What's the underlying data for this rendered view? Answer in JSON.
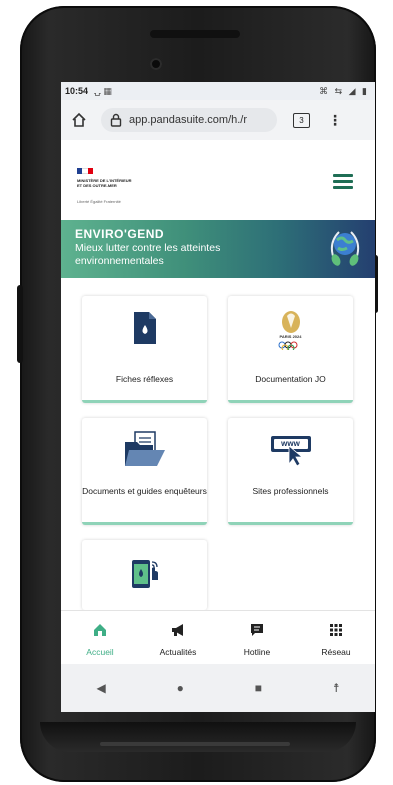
{
  "status_bar": {
    "time": "10:54",
    "left_icons": "⍽ ▦",
    "right_icons": "⌘ ⇆ ◢ ▮"
  },
  "browser": {
    "url": "app.pandasuite.com/h./r",
    "tab_count": "3"
  },
  "site": {
    "ministry": "Ministère de l'intérieur et des outre-mer",
    "devise": "Liberté Égalité Fraternité",
    "tricolor": [
      "#1f3f91",
      "#ffffff",
      "#e1000f"
    ],
    "accent_color": "#3fae86"
  },
  "banner": {
    "title": "ENVIRO'GEND",
    "subtitle": "Mieux lutter contre les atteintes environnementales"
  },
  "cards": [
    {
      "label": "Fiches réflexes",
      "icon": "file-drop-icon"
    },
    {
      "label": "Documentation JO",
      "icon": "paris-2024-logo-icon",
      "logo_text": "PARIS 2024"
    },
    {
      "label": "Documents et guides enquêteurs",
      "icon": "folder-documents-icon"
    },
    {
      "label": "Sites professionnels",
      "icon": "www-cursor-icon",
      "icon_text": "www"
    },
    {
      "label": "",
      "icon": "phone-touch-icon"
    }
  ],
  "bottom_nav": [
    {
      "label": "Accueil",
      "icon": "home-icon",
      "active": true
    },
    {
      "label": "Actualités",
      "icon": "megaphone-icon",
      "active": false
    },
    {
      "label": "Hotline",
      "icon": "chat-icon",
      "active": false
    },
    {
      "label": "Réseau",
      "icon": "grid-icon",
      "active": false
    }
  ],
  "android_nav": [
    "◀",
    "●",
    "■",
    "☨"
  ]
}
